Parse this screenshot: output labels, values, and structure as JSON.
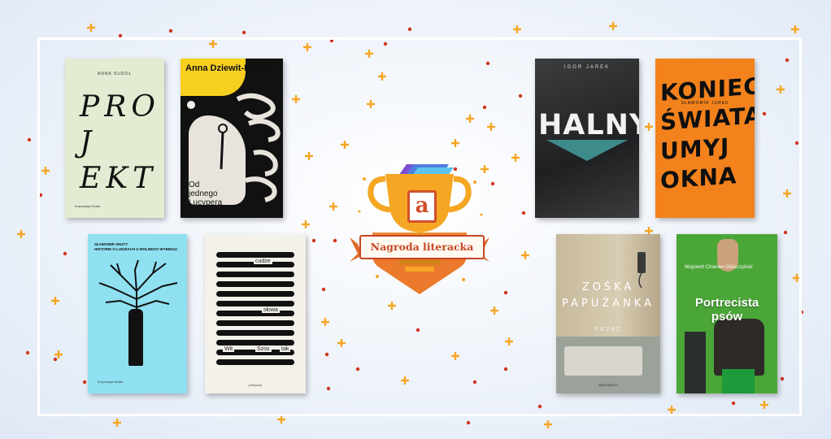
{
  "colors": {
    "accent_orange": "#f5a623",
    "accent_red": "#d0341f",
    "badge_red": "#c64522"
  },
  "badge": {
    "logo_letter": "a",
    "label": "Nagroda literacka"
  },
  "books": [
    {
      "author": "ANNA SUDOŁ",
      "title": "PRO\nJ\nEKT",
      "publisher": "Korporacja Ha!art"
    },
    {
      "author": "Anna Dziewit-Meller",
      "title": "Od\njednego\nLucypera"
    },
    {
      "author": "SŁAWOMIR SHUTY\nHISTORIE O LUDZIACH Z WOLNEGO WYBIEGU",
      "publisher": "Korporacja Ha!art"
    },
    {
      "words": [
        "cudze",
        "słowa",
        "Wit",
        "Szos",
        "tak"
      ],
      "publisher": "półwysep"
    },
    {
      "author": "IGOR JAREK",
      "title": "HALNY"
    },
    {
      "author": "SŁAWOMIR JUREK",
      "title": "KONIEC\nŚWIATA,\nUMYJ\nOKNA"
    },
    {
      "author": "ZOŚKA\nPAPUŻANKA",
      "title": "PRZEZ",
      "publisher": "MARGINESY"
    },
    {
      "author": "Wojciech Chamier-Gliszczyński",
      "title": "Portrecista\npsów"
    }
  ]
}
